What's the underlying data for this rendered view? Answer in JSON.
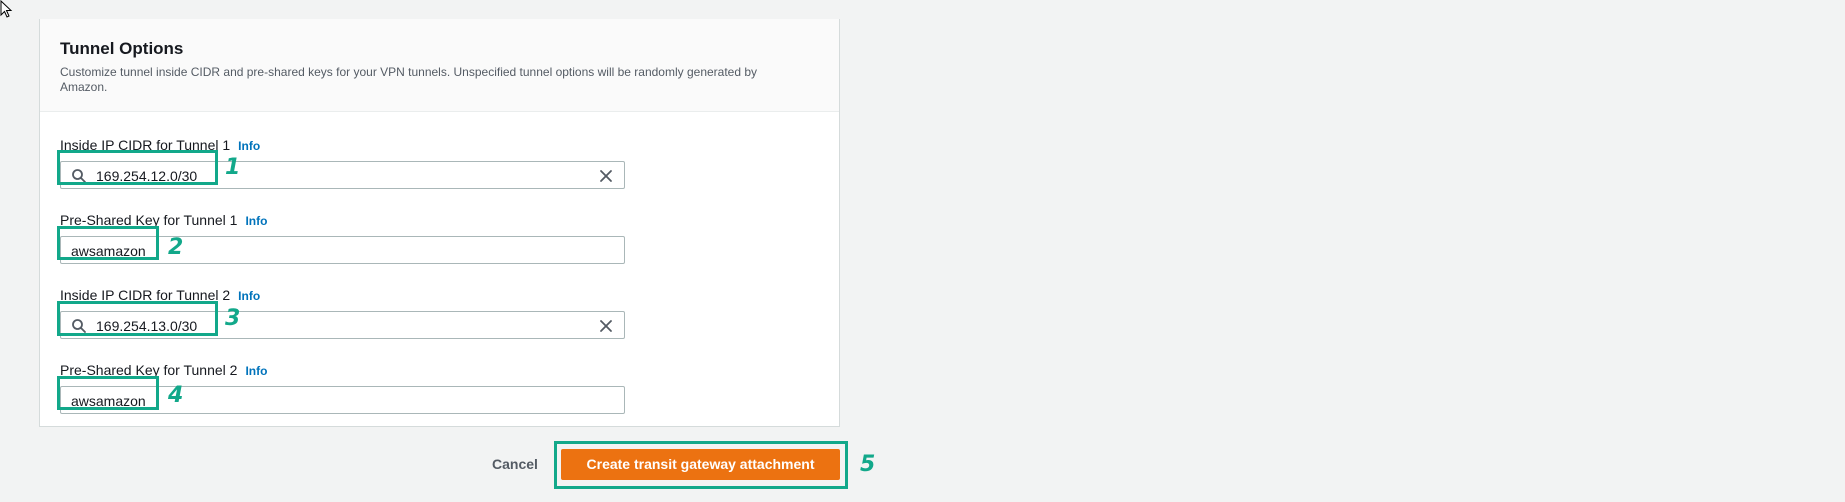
{
  "panel": {
    "title": "Tunnel Options",
    "description": "Customize tunnel inside CIDR and pre-shared keys for your VPN tunnels. Unspecified tunnel options will be randomly generated by Amazon."
  },
  "fields": [
    {
      "label": "Inside IP CIDR for Tunnel 1",
      "info": "Info",
      "value": "169.254.12.0/30",
      "type": "search-select",
      "step": "1"
    },
    {
      "label": "Pre-Shared Key for Tunnel 1",
      "info": "Info",
      "value": "awsamazon",
      "type": "text",
      "step": "2"
    },
    {
      "label": "Inside IP CIDR for Tunnel 2",
      "info": "Info",
      "value": "169.254.13.0/30",
      "type": "search-select",
      "step": "3"
    },
    {
      "label": "Pre-Shared Key for Tunnel 2",
      "info": "Info",
      "value": "awsamazon",
      "type": "text",
      "step": "4"
    }
  ],
  "actions": {
    "cancel_label": "Cancel",
    "create_label": "Create transit gateway attachment",
    "create_step": "5"
  },
  "colors": {
    "primary_button": "#ec7211",
    "annotation_highlight": "#12a88a",
    "info_link": "#0073bb"
  },
  "icons": [
    "cursor-icon",
    "search-icon",
    "clear-icon"
  ]
}
